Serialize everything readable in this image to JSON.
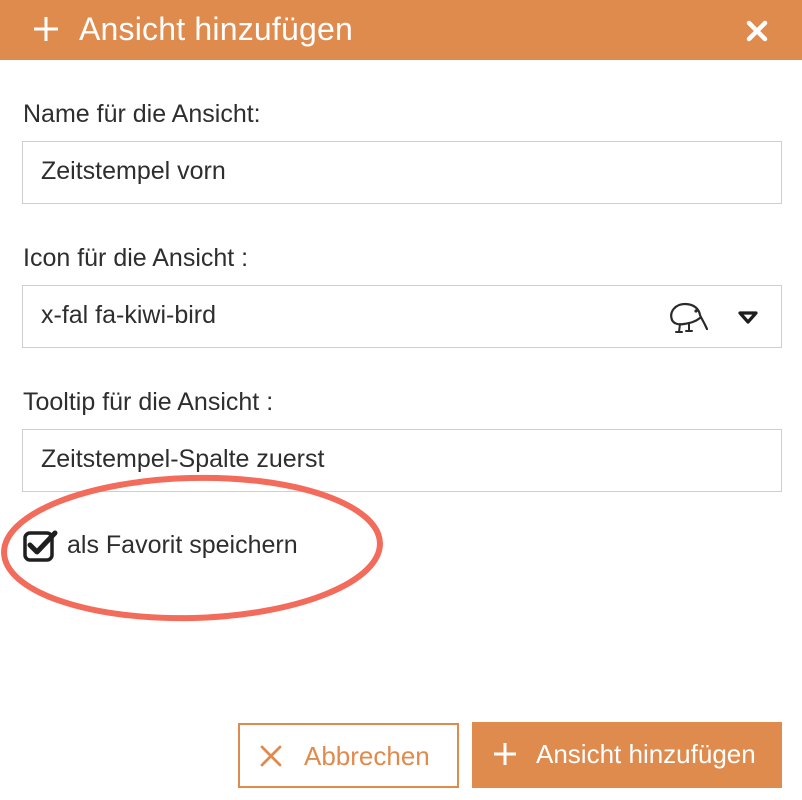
{
  "dialog": {
    "title": "Ansicht hinzufügen",
    "plus_icon": "plus-icon",
    "close_icon": "close-icon",
    "accent_color": "#e08b4e"
  },
  "form": {
    "name_label": "Name für die Ansicht:",
    "name_value": "Zeitstempel vorn",
    "icon_label": "Icon für die Ansicht :",
    "icon_value": "x-fal fa-kiwi-bird",
    "icon_preview": "kiwi-bird-icon",
    "icon_dropdown_icon": "caret-down-icon",
    "tooltip_label": "Tooltip für die Ansicht :",
    "tooltip_value": "Zeitstempel-Spalte zuerst",
    "favorite_label": "als Favorit speichern",
    "favorite_checked": true,
    "highlight_color": "#f26b5b"
  },
  "buttons": {
    "cancel_label": "Abbrechen",
    "cancel_icon": "times-icon",
    "add_label": "Ansicht hinzufügen",
    "add_icon": "plus-icon"
  }
}
